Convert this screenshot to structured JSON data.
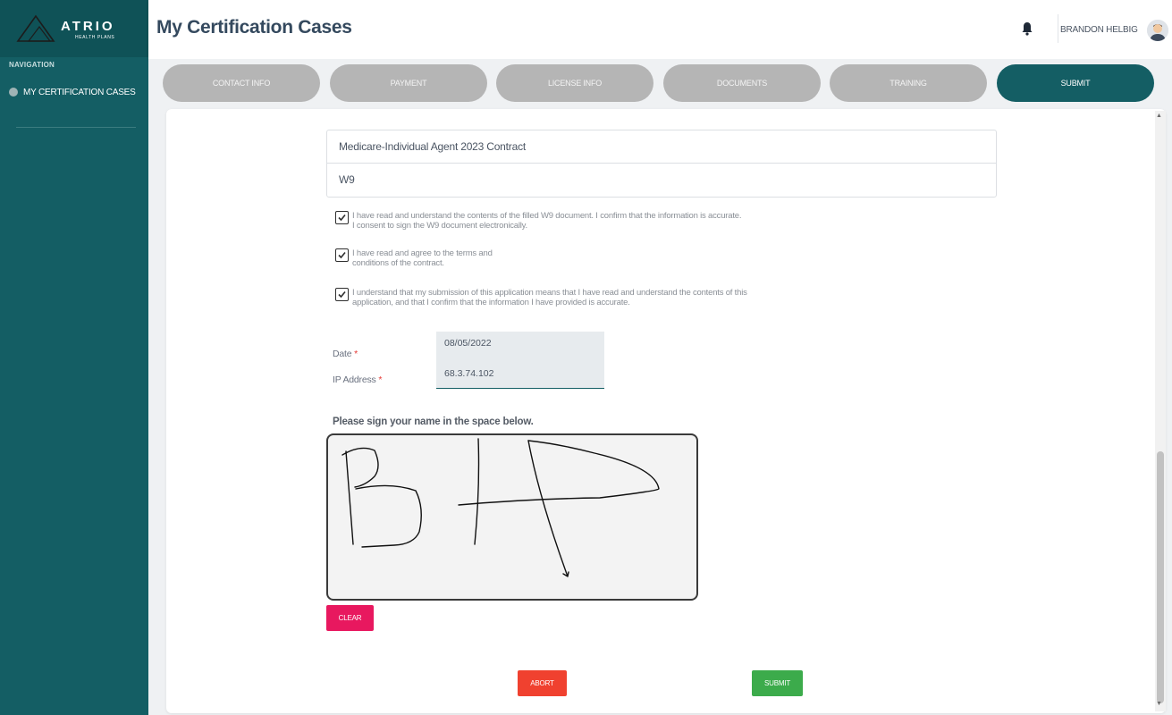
{
  "app": {
    "logo_text": "ATRIO",
    "logo_subtext": "HEALTH PLANS"
  },
  "sidebar": {
    "heading": "NAVIGATION",
    "items": [
      {
        "label": "MY CERTIFICATION CASES",
        "icon": "circle-dot-icon"
      }
    ]
  },
  "header": {
    "title": "My Certification Cases",
    "notification_icon": "bell-icon",
    "user_name": "BRANDON HELBIG",
    "avatar_icon": "user-avatar-icon"
  },
  "tabs": [
    {
      "label": "CONTACT INFO",
      "active": false
    },
    {
      "label": "PAYMENT",
      "active": false
    },
    {
      "label": "LICENSE INFO",
      "active": false
    },
    {
      "label": "DOCUMENTS",
      "active": false
    },
    {
      "label": "TRAINING",
      "active": false
    },
    {
      "label": "SUBMIT",
      "active": true
    }
  ],
  "documents": [
    "Medicare-Individual Agent 2023 Contract",
    "W9"
  ],
  "consents": [
    {
      "checked": true,
      "lines": [
        "I have read and understand the contents of the filled W9 document. I confirm that the information is accurate.",
        "I consent to sign the W9 document electronically."
      ]
    },
    {
      "checked": true,
      "lines": [
        "I have read and agree to the terms and",
        "conditions of the contract."
      ]
    },
    {
      "checked": true,
      "lines": [
        "I understand that my submission of this application means that I have read and understand the contents of this",
        "application, and that I confirm that the information I have provided is accurate."
      ]
    }
  ],
  "form": {
    "date_label": "Date",
    "date_value": "08/05/2022",
    "ip_label": "IP Address",
    "ip_value": "68.3.74.102",
    "required_mark": "*"
  },
  "signature": {
    "prompt": "Please sign your name in the space below.",
    "clear_label": "CLEAR"
  },
  "actions": {
    "abort_label": "ABORT",
    "submit_label": "SUBMIT"
  },
  "colors": {
    "primary": "#145e64",
    "tab_inactive": "#b5b5b5",
    "clear": "#e8185f",
    "abort": "#f0412f",
    "submit": "#3cab4b"
  }
}
